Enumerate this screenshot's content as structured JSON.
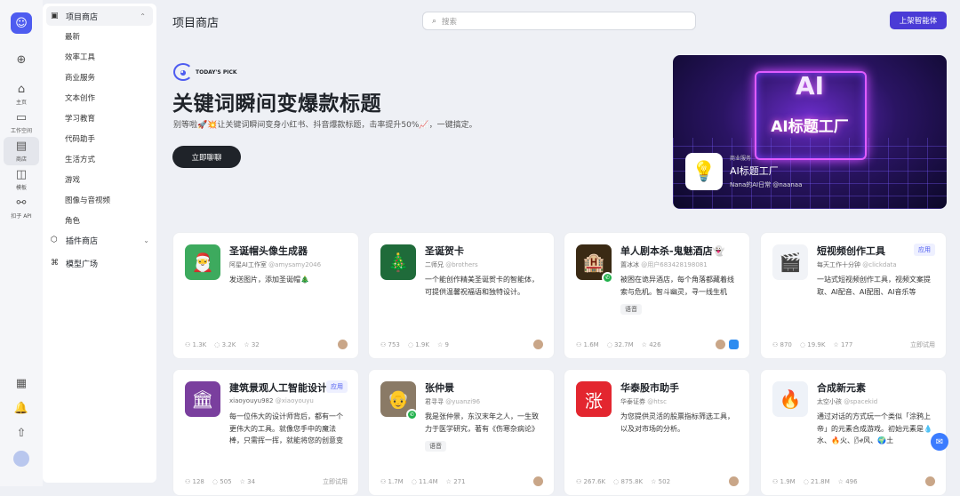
{
  "rail": {
    "items": [
      {
        "icon": "home-icon",
        "label": "主页"
      },
      {
        "icon": "workspace-icon",
        "label": "工作空间"
      },
      {
        "icon": "store-icon",
        "label": "商店"
      },
      {
        "icon": "template-icon",
        "label": "模板"
      },
      {
        "icon": "api-icon",
        "label": "扣子 API"
      }
    ]
  },
  "sidebar": {
    "store_group": "项目商店",
    "store_items": [
      "最新",
      "效率工具",
      "商业服务",
      "文本创作",
      "学习教育",
      "代码助手",
      "生活方式",
      "游戏",
      "图像与音视频",
      "角色"
    ],
    "plugin_group": "插件商店",
    "model_group": "模型广场"
  },
  "header": {
    "title": "项目商店",
    "search_placeholder": "搜索",
    "publish_label": "上架智能体"
  },
  "hero": {
    "pick_text": "TODAY'S PICK",
    "title": "关键词瞬间变爆款标题",
    "desc": "别等啦🚀💥让关键词瞬间变身小红书、抖音爆款标题，击率提升50%📈，一键搞定。",
    "button": "立即聊聊"
  },
  "banner": {
    "big": "AI",
    "big_title": "AI标题工厂",
    "category": "商业服务",
    "name": "AI标题工厂",
    "author": "Nana的AI日常",
    "handle": "@naanaa"
  },
  "cards": [
    {
      "name": "圣诞帽头像生成器",
      "author": "阿星AI工作室",
      "handle": "@amysamy2046",
      "desc": "发送图片，添加圣诞帽🎄",
      "stats": [
        "1.3K",
        "3.2K",
        "32"
      ],
      "avatar": "🎅",
      "color": "#3daa5e"
    },
    {
      "name": "圣诞贺卡",
      "author": "二师兄",
      "handle": "@brothers",
      "desc": "一个能创作精美圣诞贺卡的智能体，可提供温馨祝福语和独特设计。",
      "stats": [
        "753",
        "1.9K",
        "9"
      ],
      "avatar": "🎄",
      "color": "#1f6b3a"
    },
    {
      "name": "单人剧本杀-鬼魅酒店👻",
      "author": "置冰冰",
      "handle": "@用户683428198081",
      "desc": "被困在诡异酒店，每个角落都藏着线索与危机。智斗幽灵，寻一线生机",
      "tag": "语音",
      "stats": [
        "1.6M",
        "32.7M",
        "426"
      ],
      "avatar": "🏨",
      "color": "#3a2a14"
    },
    {
      "name": "短视频创作工具",
      "author": "每天工作十分钟",
      "handle": "@clickdata",
      "desc": "一站式短视频创作工具，视频文案提取、AI配音、AI配图、AI音乐等",
      "app": "应用",
      "stats": [
        "870",
        "19.9K",
        "177"
      ],
      "try": "立即试用",
      "avatar": "🎬",
      "color": "#f1f3f7"
    },
    {
      "name": "建筑景观人工智能设计师",
      "author": "xiaoyouyu982",
      "handle": "@xiaoyouyu",
      "desc": "每一位伟大的设计师背后，都有一个更伟大的工具。就像您手中的魔法棒，只需挥一挥，就能将您的创意变为现实",
      "app": "应用",
      "stats": [
        "128",
        "505",
        "34"
      ],
      "try": "立即试用",
      "avatar": "🏛",
      "color": "#7a3f9e"
    },
    {
      "name": "张仲景",
      "author": "君寻寻",
      "handle": "@yuanzi96",
      "desc": "我是张仲景，东汉末年之人，一生致力于医学研究，著有《伤寒杂病论》",
      "tag": "语音",
      "stats": [
        "1.7M",
        "11.4M",
        "271"
      ],
      "avatar": "👴",
      "color": "#8a7a66"
    },
    {
      "name": "华泰股市助手",
      "author": "华泰证券",
      "handle": "@htsc",
      "desc": "为您提供灵活的股票指标筛选工具，以及对市场的分析。",
      "stats": [
        "267.6K",
        "875.8K",
        "502"
      ],
      "avatar": "涨",
      "color": "#e3262f"
    },
    {
      "name": "合成新元素",
      "author": "太空小孩",
      "handle": "@spacekid",
      "desc": "通过对话的方式玩一个类似「涂鸦上帝」的元素合成游戏。初始元素是💧水、🔥火、🌬风、🌍土",
      "stats": [
        "1.9M",
        "21.8M",
        "496"
      ],
      "avatar": "🔥",
      "color": "#eef2f8"
    }
  ]
}
